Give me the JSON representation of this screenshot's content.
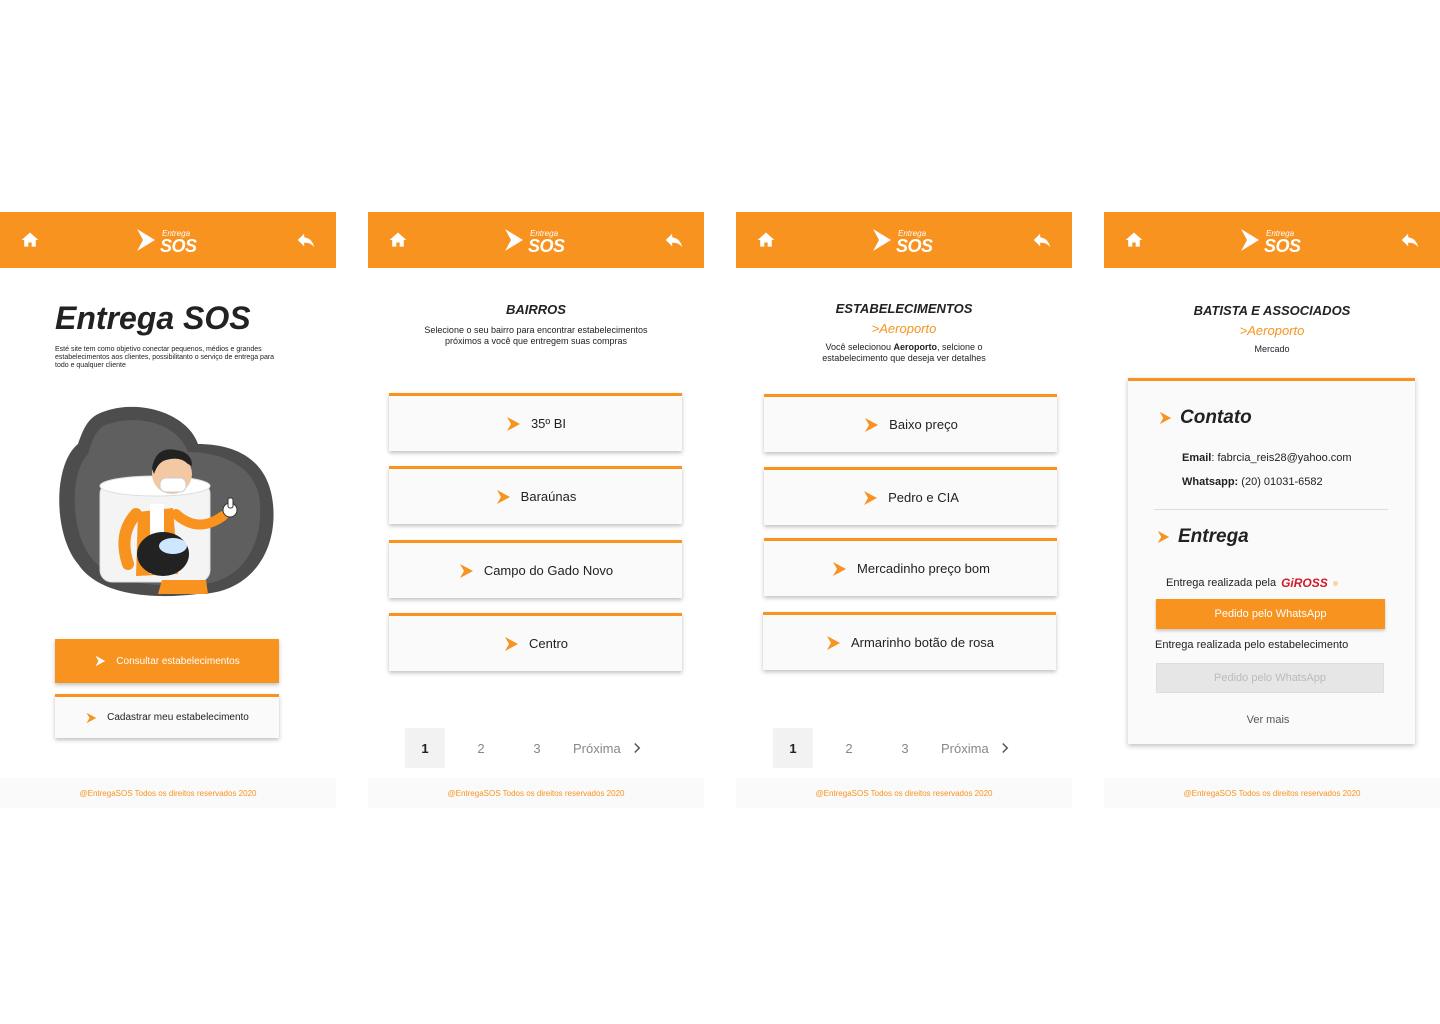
{
  "brand": {
    "logo_small": "Entrega",
    "logo_big": "SOS",
    "accent": "#f7931e"
  },
  "footer": "@EntregaSOS Todos os direitos reservados 2020",
  "screen1": {
    "title": "Entrega SOS",
    "description": "Esté site tem como objetivo conectar pequenos, médios e grandes estabelecimentos aos clientes, possibilitanto o serviço de entrega para todo e qualquer cliente",
    "primary_button": "Consultar estabelecimentos",
    "secondary_button": "Cadastrar meu estabelecimento"
  },
  "screen2": {
    "title": "BAIRROS",
    "subtitle_1": "Selecione o seu bairro para encontrar estabelecimentos",
    "subtitle_2": "próximos a você que entregem suas compras",
    "items": [
      "35º BI",
      "Baraúnas",
      "Campo do Gado Novo",
      "Centro"
    ],
    "pages": [
      "1",
      "2",
      "3"
    ],
    "next": "Próxima"
  },
  "screen3": {
    "title": "ESTABELECIMENTOS",
    "location": ">Aeroporto",
    "subtitle_a": "Você selecionou ",
    "subtitle_bold": "Aeroporto",
    "subtitle_b": ", selcione o",
    "subtitle_2": "estabelecimento que deseja ver detalhes",
    "items": [
      "Baixo preço",
      "Pedro e CIA",
      "Mercadinho preço bom",
      "Armarinho botão de rosa"
    ],
    "pages": [
      "1",
      "2",
      "3"
    ],
    "next": "Próxima"
  },
  "screen4": {
    "title": "BATISTA E ASSOCIADOS",
    "location": ">Aeroporto",
    "category": "Mercado",
    "contact_title": "Contato",
    "email_label": "Email",
    "email_value": ": fabrcia_reis28@yahoo.com",
    "whatsapp_label": "Whatsapp:",
    "whatsapp_value": " (20) 01031-6582",
    "delivery_title": "Entrega",
    "delivery_by": "Entrega realizada pela",
    "partner_logo": "GiROSS",
    "order_button": "Pedido pelo WhatsApp",
    "delivery_store": "Entrega realizada pelo estabelecimento",
    "order_button_disabled": "Pedido pelo WhatsApp",
    "see_more": "Ver mais"
  }
}
